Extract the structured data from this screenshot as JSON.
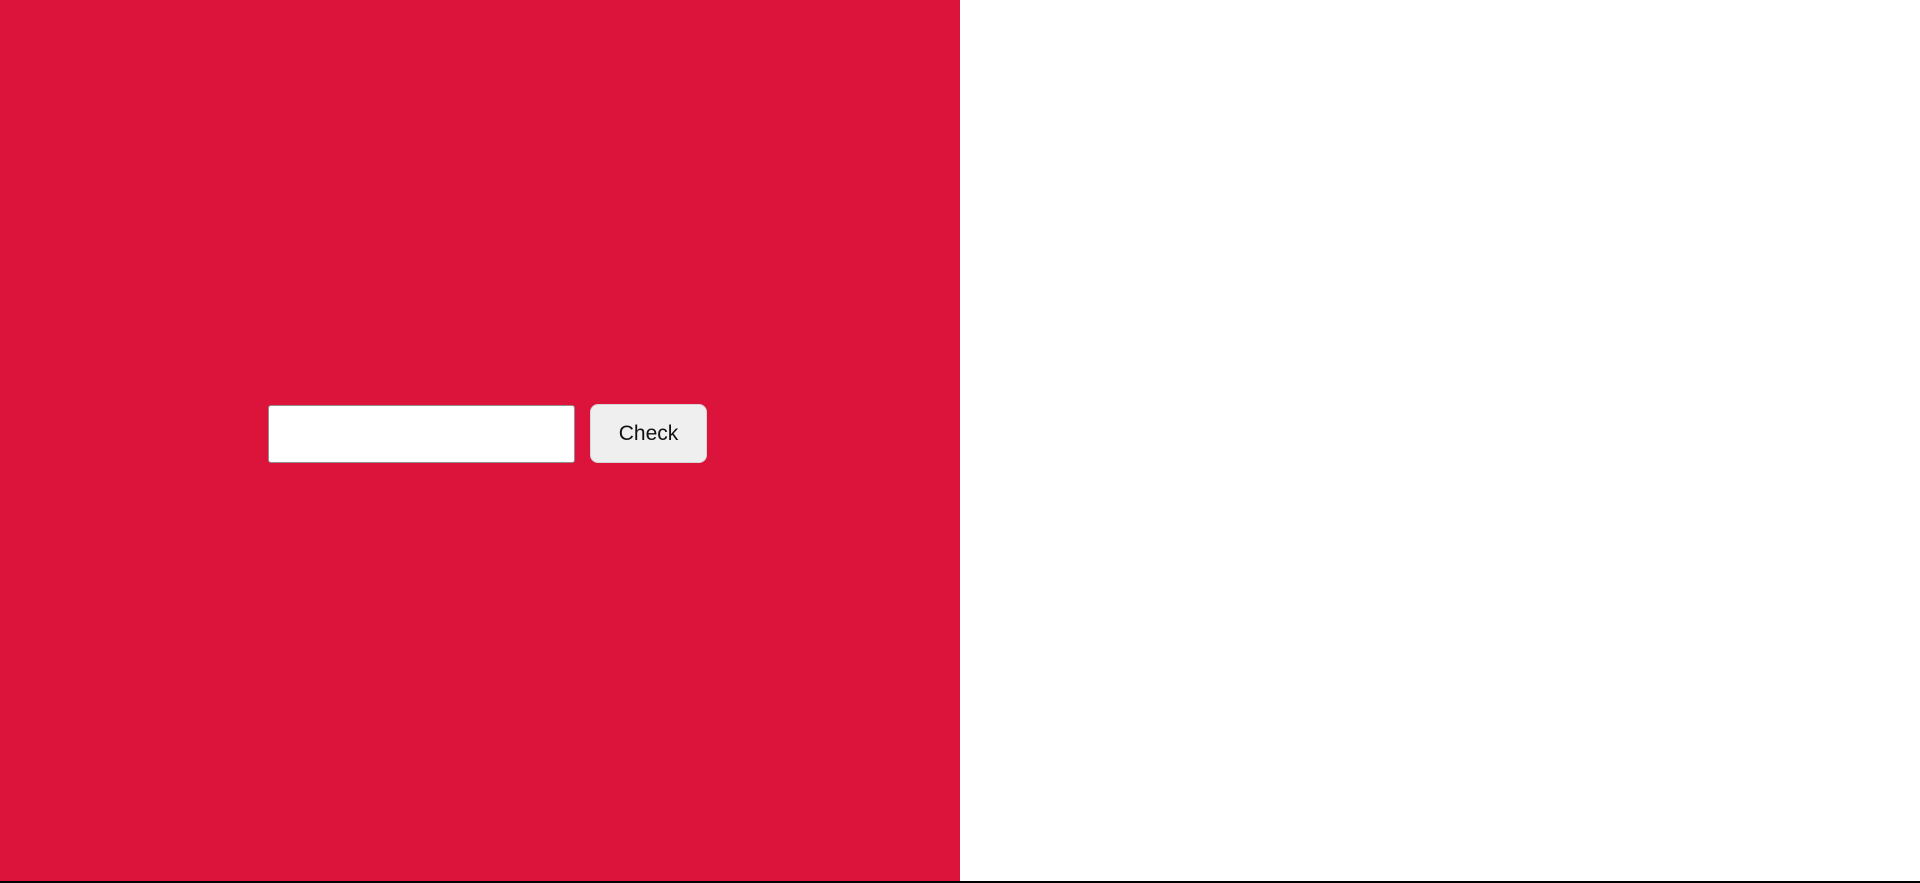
{
  "colors": {
    "left_panel": "#dc143c",
    "right_panel": "#ffffff",
    "bottom_rule": "#000000"
  },
  "form": {
    "input_value": "",
    "input_placeholder": "",
    "check_label": "Check"
  }
}
